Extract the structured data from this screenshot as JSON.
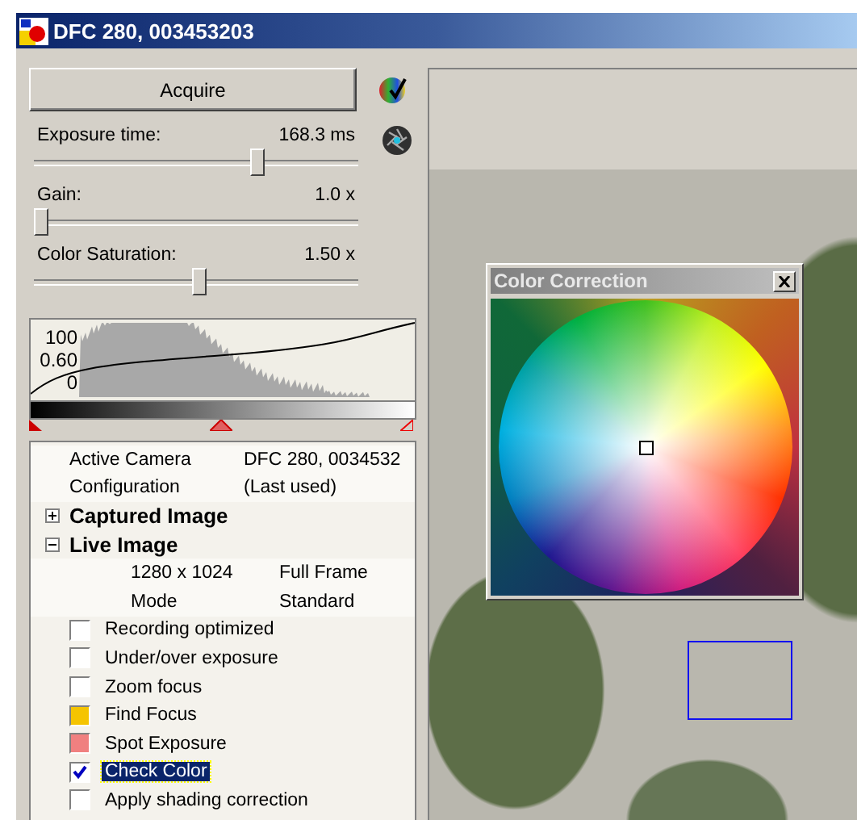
{
  "window": {
    "title": "DFC 280, 003453203"
  },
  "acquire_button": {
    "label": "Acquire"
  },
  "sliders": [
    {
      "label": "Exposure time:",
      "reading": "168.3 ms",
      "level": 0.7
    },
    {
      "label": "Gain:",
      "reading": "1.0 x",
      "level": 0.0
    },
    {
      "label": "Color Saturation:",
      "reading": "1.50 x",
      "level": 0.51
    }
  ],
  "histogram": {
    "labels": [
      "100",
      "0.60",
      "0"
    ]
  },
  "settings": [
    {
      "kind": "property",
      "label": "Active Camera",
      "value": "DFC 280, 0034532"
    },
    {
      "kind": "property",
      "label": "Configuration",
      "value": "(Last used)"
    },
    {
      "kind": "group",
      "label": "Captured Image",
      "expanded": false
    },
    {
      "kind": "group",
      "label": "Live Image",
      "expanded": true,
      "children": [
        {
          "kind": "property",
          "label": "1280 x 1024",
          "value": "Full Frame"
        },
        {
          "kind": "property",
          "label": "Mode",
          "value": "Standard"
        }
      ]
    },
    {
      "kind": "checkbox",
      "label": "Recording optimized",
      "checked": false,
      "selected": false
    },
    {
      "kind": "checkbox",
      "label": "Under/over exposure",
      "checked": false,
      "selected": false
    },
    {
      "kind": "checkbox",
      "label": "Zoom focus",
      "checked": false,
      "selected": false
    },
    {
      "kind": "color",
      "label": "Find Focus",
      "color": "#f5c400",
      "selected": false
    },
    {
      "kind": "color",
      "label": "Spot Exposure",
      "color": "#f08080",
      "selected": false
    },
    {
      "kind": "checkbox",
      "label": "Check Color",
      "checked": true,
      "selected": true
    },
    {
      "kind": "checkbox",
      "label": "Apply shading correction",
      "checked": false,
      "selected": false
    }
  ],
  "color_correction": {
    "title": "Color Correction"
  }
}
